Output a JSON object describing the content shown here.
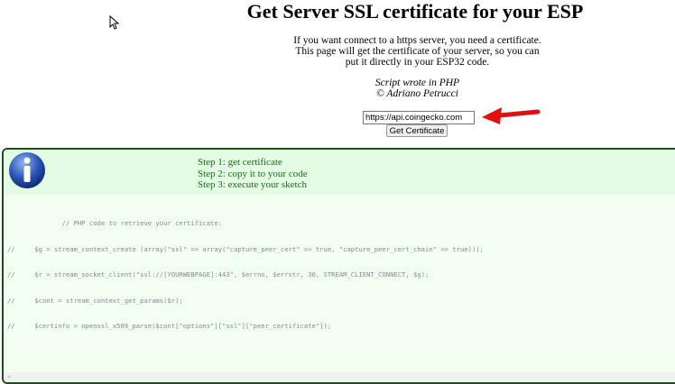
{
  "page": {
    "title": "Get Server SSL certificate for your ESP",
    "intro": [
      "If you want connect to a https server, you need a certificate.",
      "This page will get the certificate of your server, so you can",
      "put it directly in your ESP32 code."
    ],
    "credit": [
      "Script wrote in PHP",
      "© Adriano Petrucci"
    ],
    "url_value": "https://api.coingecko.com",
    "button_label": "Get Certificate"
  },
  "panel": {
    "steps": [
      "Step 1: get certificate",
      "Step 2: copy it to your code",
      "Step 3: execute your sketch"
    ],
    "code": [
      "              // PHP code to retrieve your certificate:",
      "//     $g = stream_context_create (array(\"ssl\" => array(\"capture_peer_cert\" => true, \"capture_peer_cert_chain\" => true)));",
      "//     $r = stream_socket_client(\"ssl://[YOURWEBPAGE]:443\", $errno, $errstr, 30, STREAM_CLIENT_CONNECT, $g);",
      "//     $cont = stream_context_get_params($r);",
      "//     $certinfo = openssl_x509_parse($cont[\"options\"][\"ssl\"][\"peer_certificate\"]);"
    ],
    "scroll_left": "‹"
  },
  "colors": {
    "border": "#1e4d1e",
    "panel_bg": "#f0fff0",
    "step_text": "#1a6b1a",
    "arrow": "#e01010"
  }
}
